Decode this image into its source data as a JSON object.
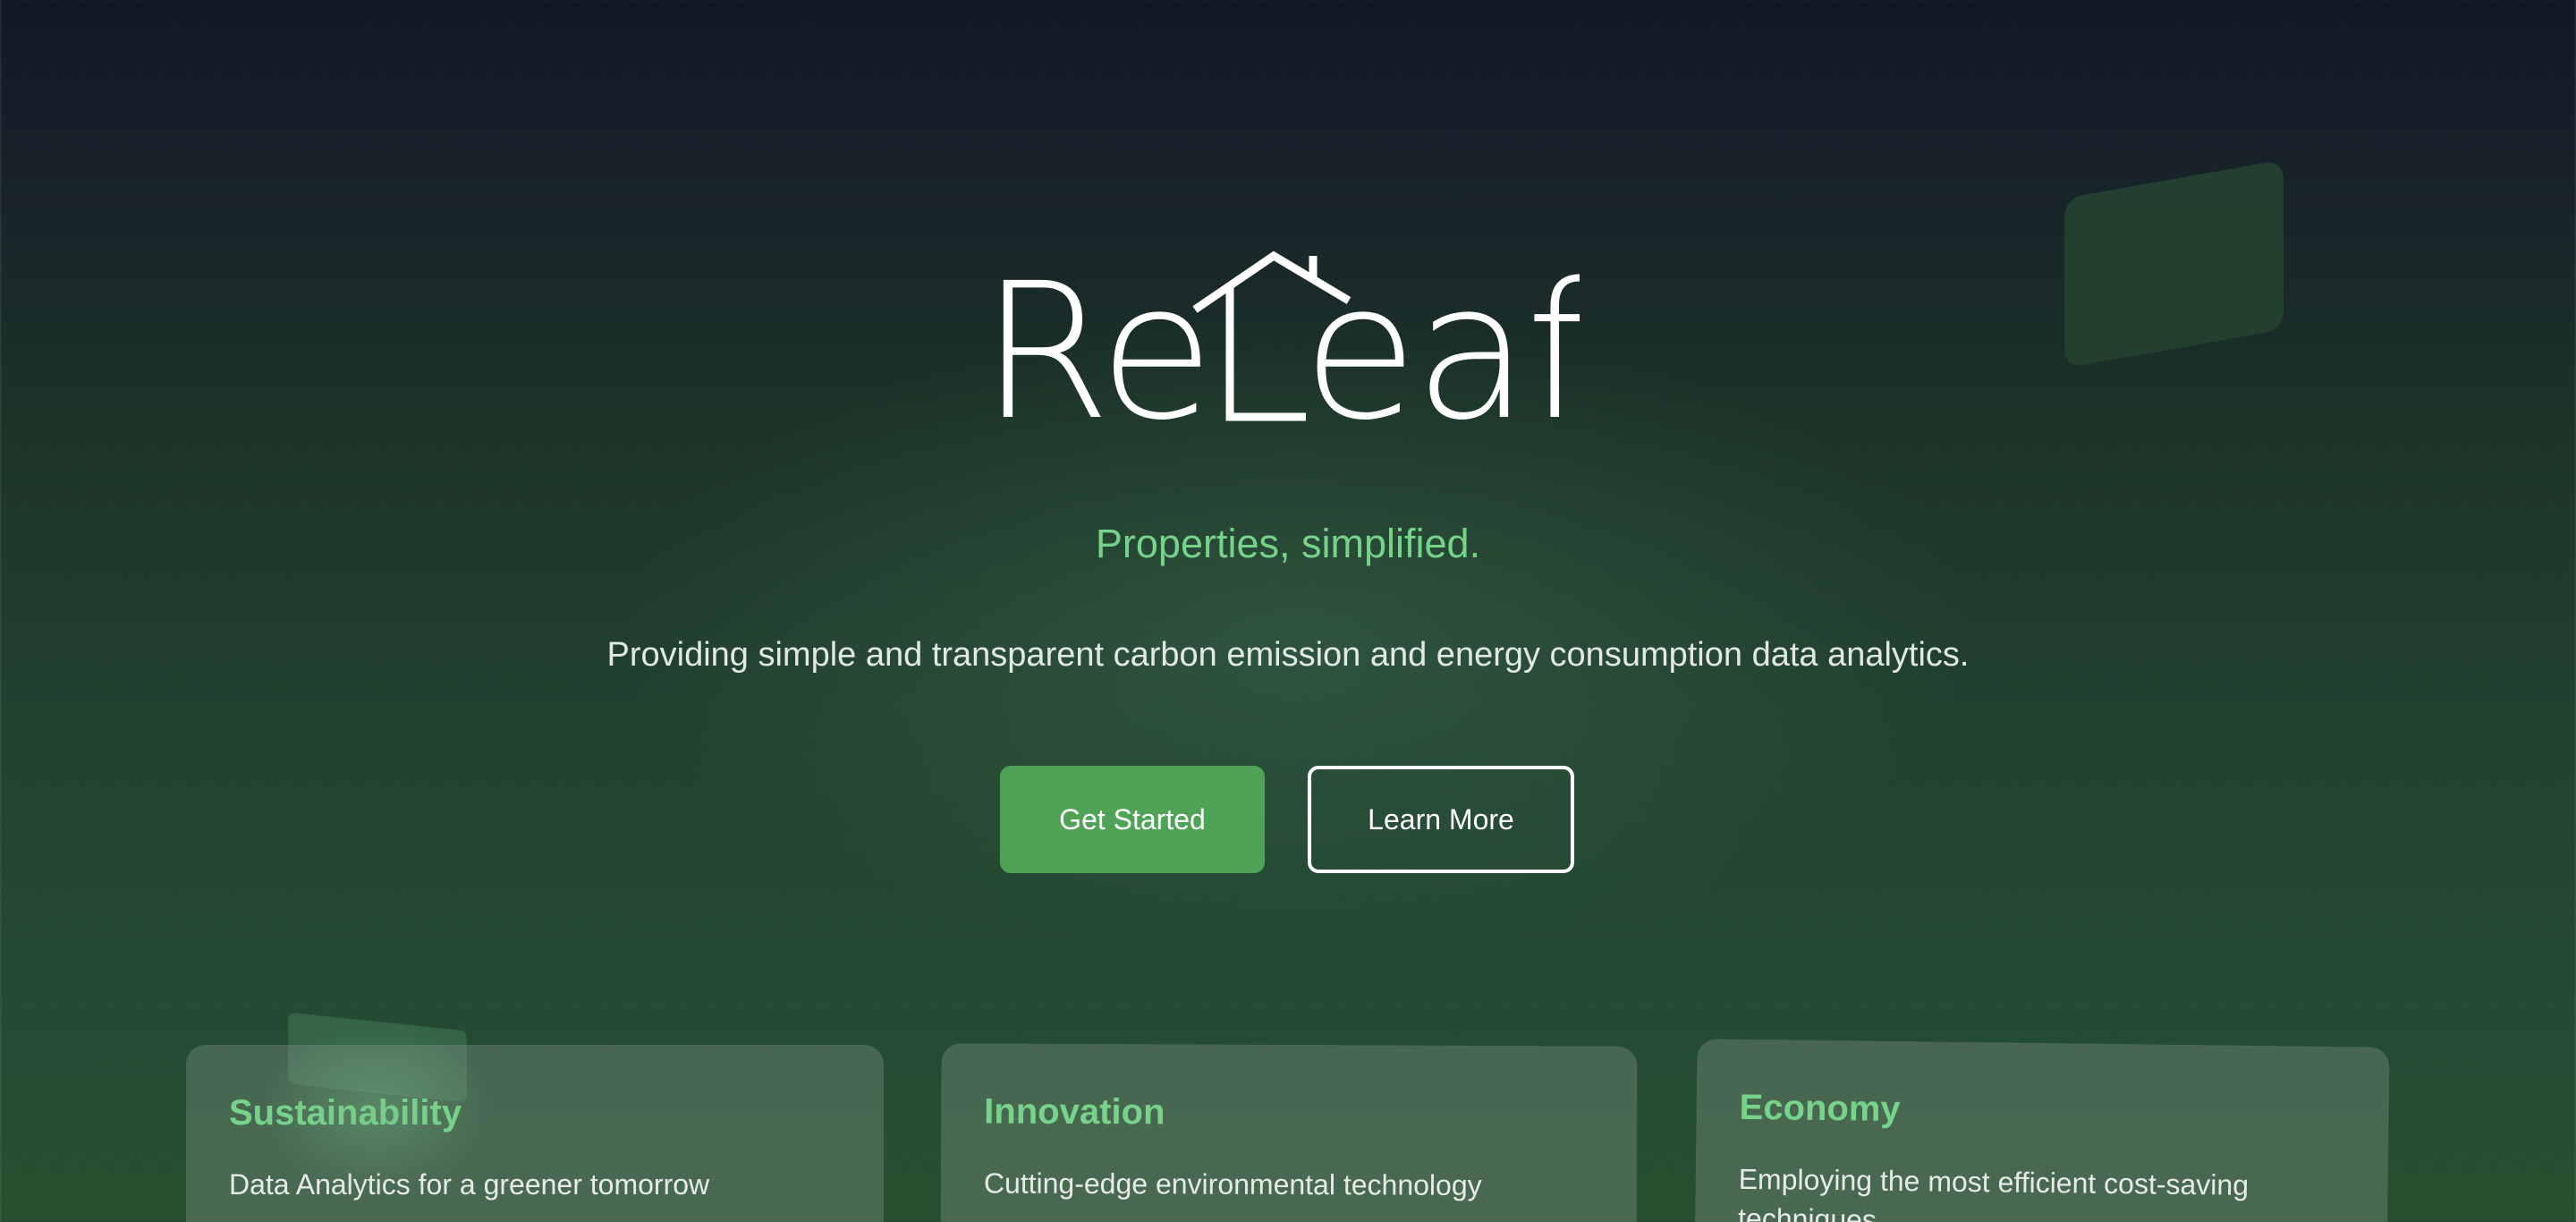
{
  "brand": {
    "name": "ReLeaf"
  },
  "hero": {
    "tagline": "Properties, simplified.",
    "description": "Providing simple and transparent carbon emission and energy consumption data analytics."
  },
  "buttons": {
    "primary_label": "Get Started",
    "secondary_label": "Learn More"
  },
  "features": [
    {
      "title": "Sustainability",
      "text": "Data Analytics for a greener tomorrow"
    },
    {
      "title": "Innovation",
      "text": "Cutting-edge environmental technology"
    },
    {
      "title": "Economy",
      "text": "Employing the most efficient cost-saving techniques"
    }
  ],
  "colors": {
    "accent": "#76d38a",
    "primary_button": "#4ea356",
    "background_top": "#121826",
    "background_bottom": "#26502f"
  },
  "icons": {
    "logo_mark": "house-roof-icon"
  }
}
